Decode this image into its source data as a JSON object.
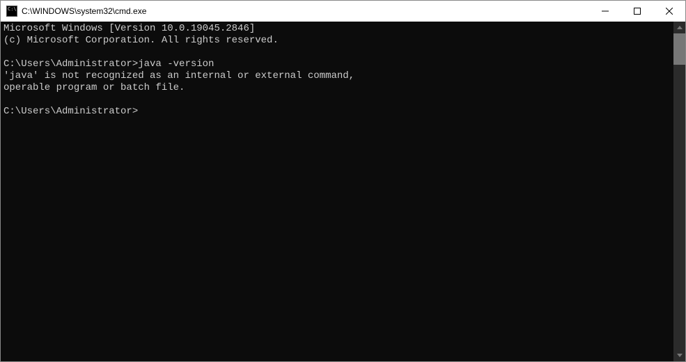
{
  "window": {
    "title": "C:\\WINDOWS\\system32\\cmd.exe"
  },
  "terminal": {
    "lines": [
      "Microsoft Windows [Version 10.0.19045.2846]",
      "(c) Microsoft Corporation. All rights reserved.",
      "",
      "C:\\Users\\Administrator>java -version",
      "'java' is not recognized as an internal or external command,",
      "operable program or batch file.",
      "",
      "C:\\Users\\Administrator>"
    ]
  }
}
